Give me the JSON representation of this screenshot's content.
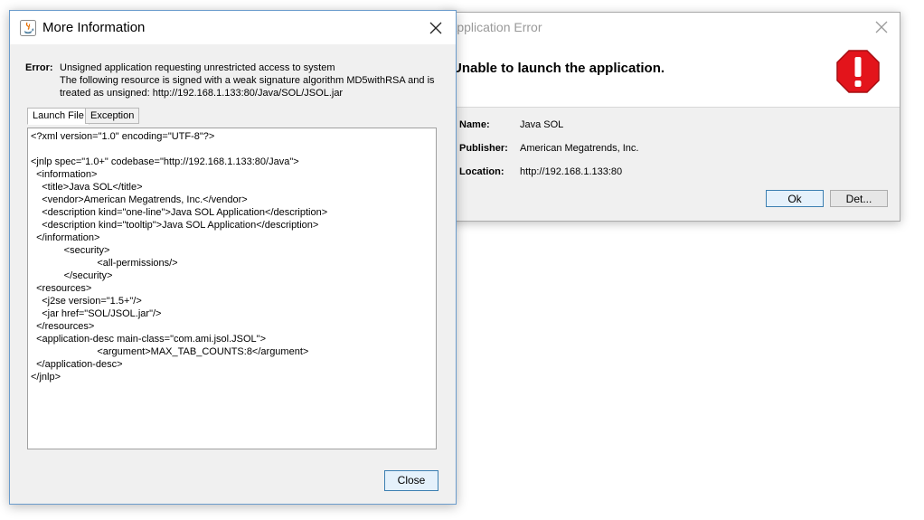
{
  "error_dialog": {
    "title": "Application Error",
    "headline": "Unable to launch the application.",
    "fields": [
      {
        "label": "Name:",
        "value": "Java SOL"
      },
      {
        "label": "Publisher:",
        "value": "American Megatrends, Inc."
      },
      {
        "label": "Location:",
        "value": "http://192.168.1.133:80"
      }
    ],
    "ok_label": "Ok",
    "details_label": "Det...",
    "stop_icon_color": "#e3141b"
  },
  "info_dialog": {
    "title": "More Information",
    "error_label": "Error:",
    "error_lines": [
      "Unsigned application requesting unrestricted access to system",
      "The following resource is signed with a weak signature algorithm MD5withRSA and is",
      "treated as unsigned: http://192.168.1.133:80/Java/SOL/JSOL.jar"
    ],
    "tabs": [
      {
        "label": "Launch File",
        "active": true
      },
      {
        "label": "Exception",
        "active": false
      }
    ],
    "xml_lines": [
      "<?xml version=\"1.0\" encoding=\"UTF-8\"?>",
      "",
      "<jnlp spec=\"1.0+\" codebase=\"http://192.168.1.133:80/Java\">",
      "  <information>",
      "    <title>Java SOL</title>",
      "    <vendor>American Megatrends, Inc.</vendor>",
      "    <description kind=\"one-line\">Java SOL Application</description>",
      "    <description kind=\"tooltip\">Java SOL Application</description>",
      "  </information>",
      "            <security>",
      "                        <all-permissions/>",
      "            </security>",
      "  <resources>",
      "    <j2se version=\"1.5+\"/>",
      "    <jar href=\"SOL/JSOL.jar\"/>",
      "  </resources>",
      "  <application-desc main-class=\"com.ami.jsol.JSOL\">",
      "                        <argument>MAX_TAB_COUNTS:8</argument>",
      "  </application-desc>",
      "</jnlp>"
    ],
    "close_label": "Close"
  }
}
